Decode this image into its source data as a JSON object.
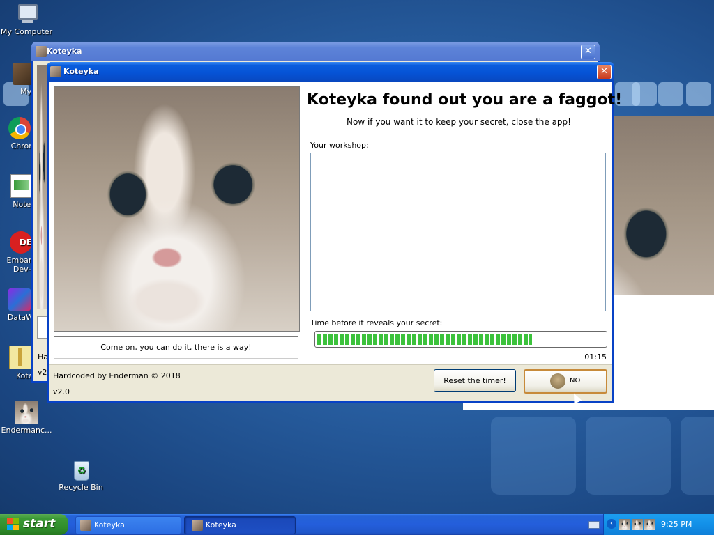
{
  "desktop": {
    "icons": [
      {
        "label": "My Computer",
        "icon": "my-computer-icon"
      },
      {
        "label": "MyPa",
        "icon": "shortcut-icon"
      },
      {
        "label": "Chrom",
        "icon": "chrome-icon"
      },
      {
        "label": "Notepa",
        "icon": "notepad-icon"
      },
      {
        "label": "Embarca",
        "label2": "Dev-C",
        "icon": "devcpp-icon"
      },
      {
        "label": "DataWa",
        "icon": "datawatch-icon"
      },
      {
        "label": "Kotey",
        "icon": "koteyka-icon"
      },
      {
        "label": "Endermanc...",
        "icon": "cat-photo-icon"
      },
      {
        "label": "Recycle Bin",
        "icon": "recycle-bin-icon"
      }
    ]
  },
  "back_window": {
    "title": "Koteyka",
    "partial_text_1": "Ha",
    "partial_text_2": "v2"
  },
  "main_window": {
    "title": "Koteyka",
    "heading": "Koteyka found out you are a faggot!",
    "subheading": "Now if you want it to keep your secret, close the app!",
    "workshop_label": "Your workshop:",
    "workshop_value": "",
    "timer_label": "Time before it reveals your secret:",
    "progress_fraction": 0.75,
    "timer_value": "01:15",
    "hint": "Come on, you can do it, there is a way!",
    "credits": "Hardcoded by Enderman © 2018",
    "version": "v2.0",
    "reset_button": "Reset the timer!",
    "no_button": "NO"
  },
  "taskbar": {
    "start_label": "start",
    "tasks": [
      {
        "label": "Koteyka",
        "active": false
      },
      {
        "label": "Koteyka",
        "active": true
      }
    ],
    "clock": "9:25 PM"
  },
  "colors": {
    "progress_green": "#3cc23c",
    "xp_blue": "#0a5ddd",
    "start_green": "#3c9a36"
  }
}
